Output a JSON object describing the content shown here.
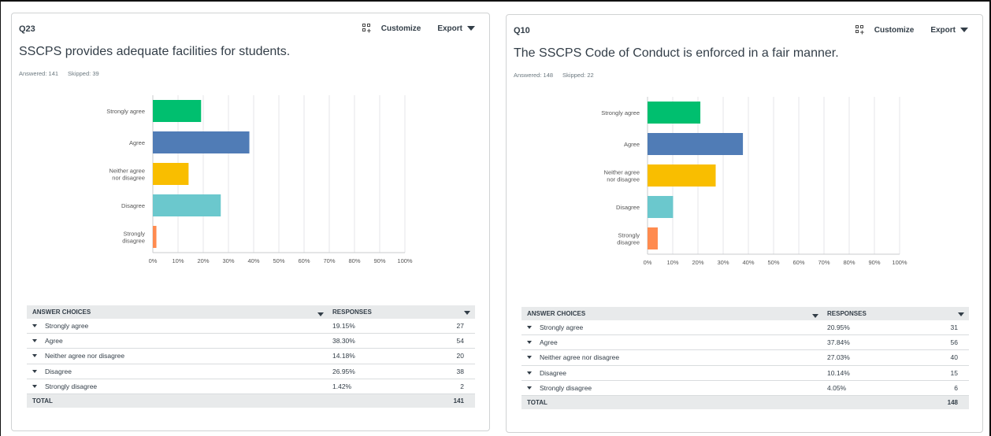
{
  "colors": {
    "strongly_agree": "#00bf6f",
    "agree": "#507cb6",
    "neither": "#f9be00",
    "disagree": "#6bc8cd",
    "strongly_disagree": "#ff8b4f"
  },
  "panels": [
    {
      "qnum": "Q23",
      "customize": "Customize",
      "export": "Export",
      "title": "SSCPS provides adequate facilities for students.",
      "answered": "Answered: 141",
      "skipped": "Skipped: 39",
      "table": {
        "header_choices": "ANSWER CHOICES",
        "header_responses": "RESPONSES",
        "rows": [
          {
            "choice": "Strongly agree",
            "pct": "19.15%",
            "count": "27"
          },
          {
            "choice": "Agree",
            "pct": "38.30%",
            "count": "54"
          },
          {
            "choice": "Neither agree nor disagree",
            "pct": "14.18%",
            "count": "20"
          },
          {
            "choice": "Disagree",
            "pct": "26.95%",
            "count": "38"
          },
          {
            "choice": "Strongly disagree",
            "pct": "1.42%",
            "count": "2"
          }
        ],
        "total_label": "TOTAL",
        "total": "141"
      }
    },
    {
      "qnum": "Q10",
      "customize": "Customize",
      "export": "Export",
      "title": "The SSCPS Code of Conduct is enforced in a fair manner.",
      "answered": "Answered: 148",
      "skipped": "Skipped: 22",
      "table": {
        "header_choices": "ANSWER CHOICES",
        "header_responses": "RESPONSES",
        "rows": [
          {
            "choice": "Strongly agree",
            "pct": "20.95%",
            "count": "31"
          },
          {
            "choice": "Agree",
            "pct": "37.84%",
            "count": "56"
          },
          {
            "choice": "Neither agree nor disagree",
            "pct": "27.03%",
            "count": "40"
          },
          {
            "choice": "Disagree",
            "pct": "10.14%",
            "count": "15"
          },
          {
            "choice": "Strongly disagree",
            "pct": "4.05%",
            "count": "6"
          }
        ],
        "total_label": "TOTAL",
        "total": "148"
      }
    }
  ],
  "chart_data": [
    {
      "type": "bar",
      "orientation": "horizontal",
      "categories": [
        [
          "Strongly agree"
        ],
        [
          "Agree"
        ],
        [
          "Neither agree",
          "nor disagree"
        ],
        [
          "Disagree"
        ],
        [
          "Strongly",
          "disagree"
        ]
      ],
      "values": [
        19.15,
        38.3,
        14.18,
        26.95,
        1.42
      ],
      "xticks": [
        "0%",
        "10%",
        "20%",
        "30%",
        "40%",
        "50%",
        "60%",
        "70%",
        "80%",
        "90%",
        "100%"
      ],
      "xlim": [
        0,
        100
      ],
      "grid": true
    },
    {
      "type": "bar",
      "orientation": "horizontal",
      "categories": [
        [
          "Strongly agree"
        ],
        [
          "Agree"
        ],
        [
          "Neither agree",
          "nor disagree"
        ],
        [
          "Disagree"
        ],
        [
          "Strongly",
          "disagree"
        ]
      ],
      "values": [
        20.95,
        37.84,
        27.03,
        10.14,
        4.05
      ],
      "xticks": [
        "0%",
        "10%",
        "20%",
        "30%",
        "40%",
        "50%",
        "60%",
        "70%",
        "80%",
        "90%",
        "100%"
      ],
      "xlim": [
        0,
        100
      ],
      "grid": true
    }
  ]
}
